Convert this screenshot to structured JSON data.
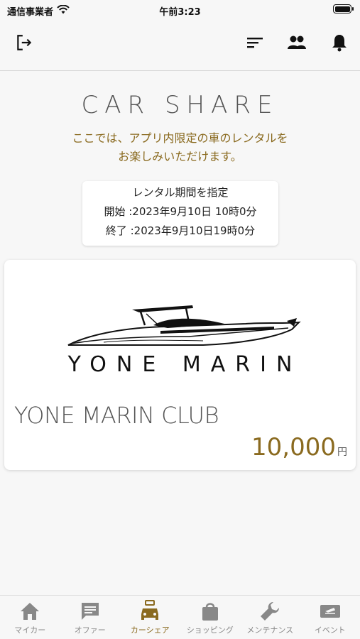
{
  "status_bar": {
    "carrier": "通信事業者",
    "time": "午前3:23"
  },
  "header": {
    "title": "CAR SHARE",
    "subtitle_line1": "ここでは、アプリ内限定の車のレンタルを",
    "subtitle_line2": "お楽しみいただけます。"
  },
  "rental_period": {
    "heading": "レンタル期間を指定",
    "start": "開始 :2023年9月10日 10時0分",
    "end": "終了 :2023年9月10日19時0分"
  },
  "card": {
    "logo_text": "YONE MARIN",
    "name": "YONE MARIN CLUB",
    "price": "10,000",
    "unit": "円"
  },
  "tabs": [
    {
      "label": "マイカー",
      "icon": "home-icon"
    },
    {
      "label": "オファー",
      "icon": "chat-icon"
    },
    {
      "label": "カーシェア",
      "icon": "car-share-icon"
    },
    {
      "label": "ショッピング",
      "icon": "shopping-bag-icon"
    },
    {
      "label": "メンテナンス",
      "icon": "wrench-icon"
    },
    {
      "label": "イベント",
      "icon": "ticket-icon"
    }
  ],
  "colors": {
    "accent": "#8a6a1f",
    "inactive": "#888888"
  }
}
